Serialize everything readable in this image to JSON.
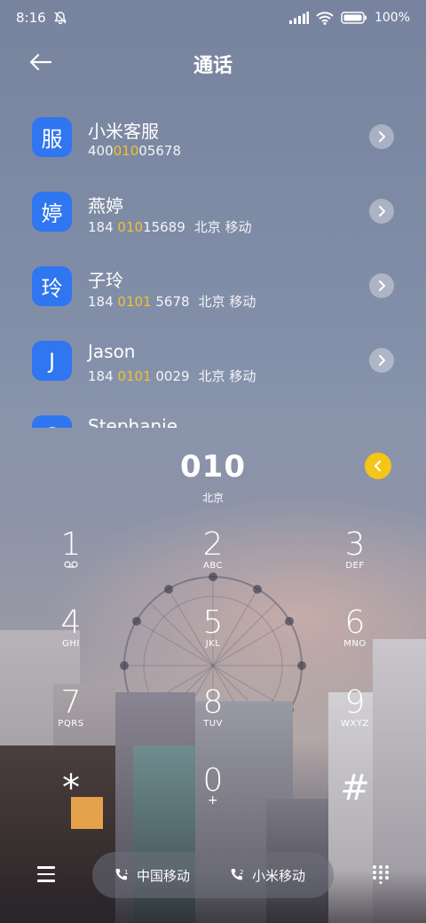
{
  "status": {
    "time": "8:16",
    "battery": "100%"
  },
  "header": {
    "title": "通话"
  },
  "contacts": [
    {
      "avatar": "服",
      "name": "小米客服",
      "num_before": "400",
      "num_hl": "010",
      "num_after": "05678",
      "location": ""
    },
    {
      "avatar": "婷",
      "name": "燕婷",
      "num_before": "184 ",
      "num_hl": "010",
      "num_after": "15689",
      "location": "北京 移动"
    },
    {
      "avatar": "玲",
      "name": "子玲",
      "num_before": "184 ",
      "num_hl": "0101",
      "num_after": " 5678",
      "location": "北京 移动"
    },
    {
      "avatar": "J",
      "name": "Jason",
      "num_before": "184 ",
      "num_hl": "0101",
      "num_after": " 0029",
      "location": "北京 移动"
    },
    {
      "avatar": "S",
      "name": "Stephanie",
      "num_before": "",
      "num_hl": "",
      "num_after": "",
      "location": ""
    }
  ],
  "dialer": {
    "number": "010",
    "location": "北京",
    "keys": [
      {
        "digit": "1",
        "letters": "voicemail"
      },
      {
        "digit": "2",
        "letters": "ABC"
      },
      {
        "digit": "3",
        "letters": "DEF"
      },
      {
        "digit": "4",
        "letters": "GHI"
      },
      {
        "digit": "5",
        "letters": "JKL"
      },
      {
        "digit": "6",
        "letters": "MNO"
      },
      {
        "digit": "7",
        "letters": "PQRS"
      },
      {
        "digit": "8",
        "letters": "TUV"
      },
      {
        "digit": "9",
        "letters": "WXYZ"
      },
      {
        "digit": "*",
        "letters": ""
      },
      {
        "digit": "0",
        "letters": "+"
      },
      {
        "digit": "#",
        "letters": ""
      }
    ]
  },
  "bottom": {
    "sim1_label": "中国移动",
    "sim2_label": "小米移动"
  },
  "colors": {
    "accent_blue": "#2f76f0",
    "highlight_yellow": "#f2c128",
    "backspace_yellow": "#f5c518"
  }
}
